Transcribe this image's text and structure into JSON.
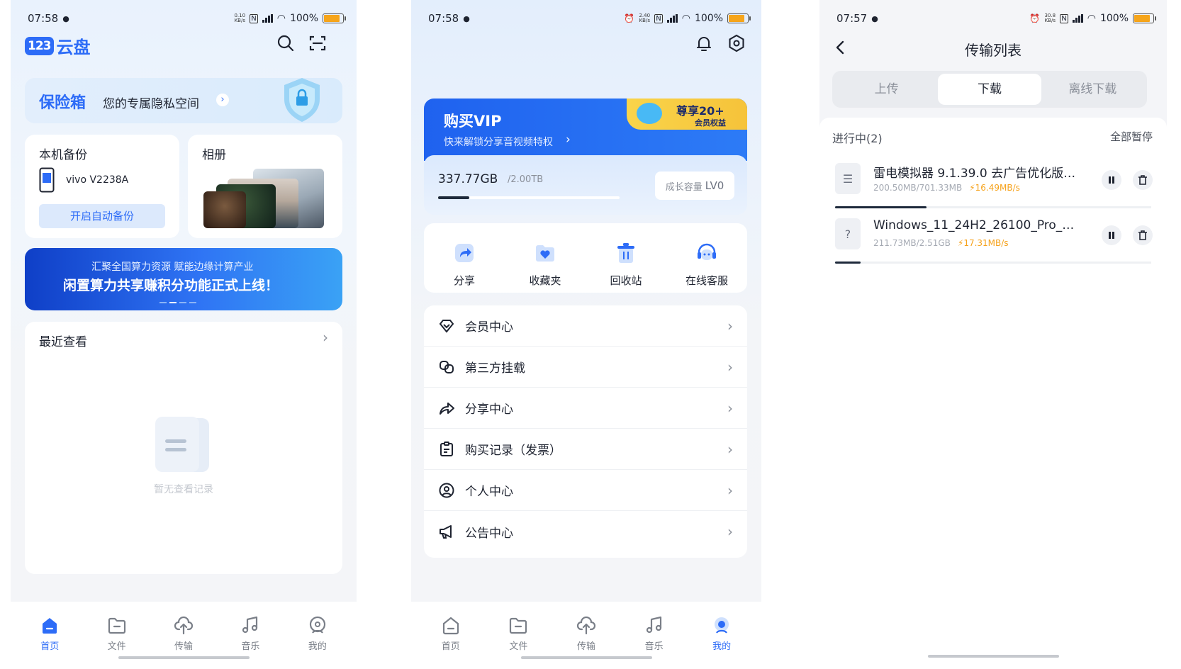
{
  "colors": {
    "accent": "#2d6cf7",
    "speed": "#f6a21b",
    "vip_gold": "#f9d44a"
  },
  "screen1": {
    "status": {
      "time": "07:58",
      "net_speed": "0.10 KB/s",
      "battery": "100%",
      "battery_level": 0.85
    },
    "logo_badge": "123",
    "logo_text": "云盘",
    "vault": {
      "title": "保险箱",
      "subtitle": "您的专属隐私空间"
    },
    "backup": {
      "title": "本机备份",
      "device": "vivo V2238A",
      "button": "开启自动备份"
    },
    "album": {
      "title": "相册"
    },
    "banner": {
      "line1": "汇聚全国算力资源  赋能边缘计算产业",
      "line2": "闲置算力共享赚积分功能正式上线！"
    },
    "recent": {
      "title": "最近查看",
      "empty": "暂无查看记录"
    },
    "nav": [
      {
        "label": "首页",
        "icon": "home-icon",
        "active": true
      },
      {
        "label": "文件",
        "icon": "folder-icon"
      },
      {
        "label": "传输",
        "icon": "cloud-transfer-icon"
      },
      {
        "label": "音乐",
        "icon": "music-icon"
      },
      {
        "label": "我的",
        "icon": "profile-icon"
      }
    ]
  },
  "screen2": {
    "status": {
      "time": "07:58",
      "net_speed": "2.40 KB/s",
      "battery": "100%",
      "battery_level": 0.85
    },
    "vip": {
      "title": "购买VIP",
      "subtitle": "快来解锁分享音视频特权",
      "badge_top": "尊享20+",
      "badge_bottom": "会员权益"
    },
    "storage": {
      "used": "337.77GB",
      "total": "/2.00TB",
      "fraction": 0.17,
      "growth": "成长容量",
      "level": "LV0"
    },
    "quick": [
      {
        "label": "分享",
        "icon": "share-icon"
      },
      {
        "label": "收藏夹",
        "icon": "favorites-icon"
      },
      {
        "label": "回收站",
        "icon": "recycle-bin-icon"
      },
      {
        "label": "在线客服",
        "icon": "customer-service-icon"
      }
    ],
    "menu": [
      {
        "label": "会员中心",
        "icon": "diamond-icon"
      },
      {
        "label": "第三方挂载",
        "icon": "link-icon"
      },
      {
        "label": "分享中心",
        "icon": "share-arrow-icon"
      },
      {
        "label": "购买记录（发票）",
        "icon": "receipt-icon"
      },
      {
        "label": "个人中心",
        "icon": "user-circle-icon"
      },
      {
        "label": "公告中心",
        "icon": "megaphone-icon"
      }
    ],
    "nav": [
      {
        "label": "首页",
        "icon": "home-icon"
      },
      {
        "label": "文件",
        "icon": "folder-icon"
      },
      {
        "label": "传输",
        "icon": "cloud-transfer-icon"
      },
      {
        "label": "音乐",
        "icon": "music-icon"
      },
      {
        "label": "我的",
        "icon": "profile-icon",
        "active": true
      }
    ]
  },
  "screen3": {
    "status": {
      "time": "07:57",
      "net_speed": "30.8 KB/s",
      "battery": "100%",
      "battery_level": 0.85
    },
    "title": "传输列表",
    "tabs": [
      {
        "label": "上传"
      },
      {
        "label": "下载",
        "active": true
      },
      {
        "label": "离线下载"
      }
    ],
    "section": {
      "label": "进行中(2)",
      "action": "全部暂停"
    },
    "items": [
      {
        "name": "雷电模拟器 9.1.39.0 去广告优化版…",
        "size": "200.50MB/701.33MB",
        "speed": "16.49MB/s",
        "progress": 0.29,
        "icon": "zip-icon"
      },
      {
        "name": "Windows_11_24H2_26100_Pro_…",
        "size": "211.73MB/2.51GB",
        "speed": "17.31MB/s",
        "progress": 0.08,
        "icon": "unknown-file-icon"
      }
    ]
  }
}
